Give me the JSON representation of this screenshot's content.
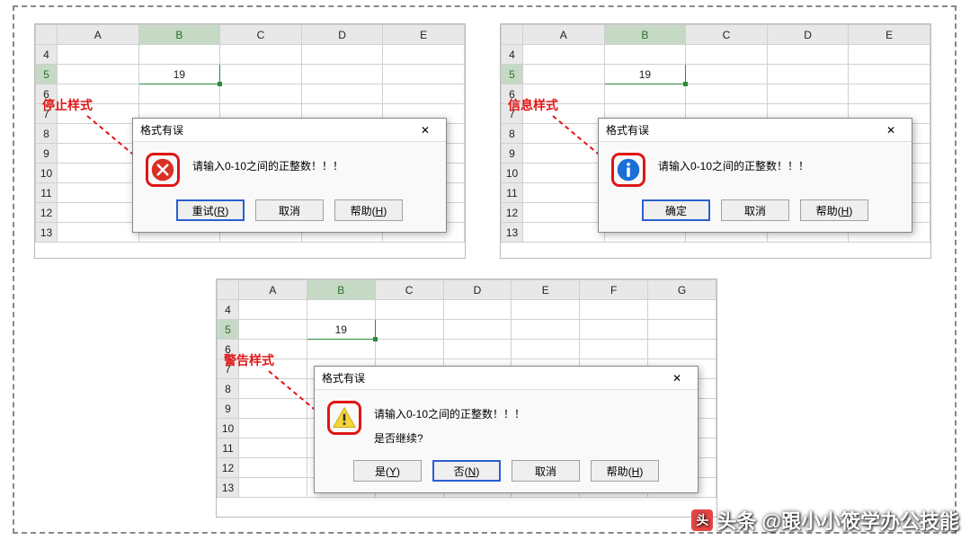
{
  "columns": [
    "A",
    "B",
    "C",
    "D",
    "E"
  ],
  "columns_wide": [
    "A",
    "B",
    "C",
    "D",
    "E",
    "F",
    "G"
  ],
  "rows": [
    "4",
    "5",
    "6",
    "7",
    "8",
    "9",
    "10",
    "11",
    "12",
    "13"
  ],
  "cell_value": "19",
  "labels": {
    "stop": "停止样式",
    "info": "信息样式",
    "warn": "警告样式"
  },
  "dialog": {
    "title": "格式有误",
    "msg": "请输入0-10之间的正整数！！！",
    "warn_extra": "是否继续?",
    "retry": "重试(R)",
    "ok": "确定",
    "cancel": "取消",
    "help": "帮助(H)",
    "yes": "是(Y)",
    "no": "否(N)"
  },
  "watermark": "头条 @跟小小筱学办公技能",
  "close": "✕"
}
